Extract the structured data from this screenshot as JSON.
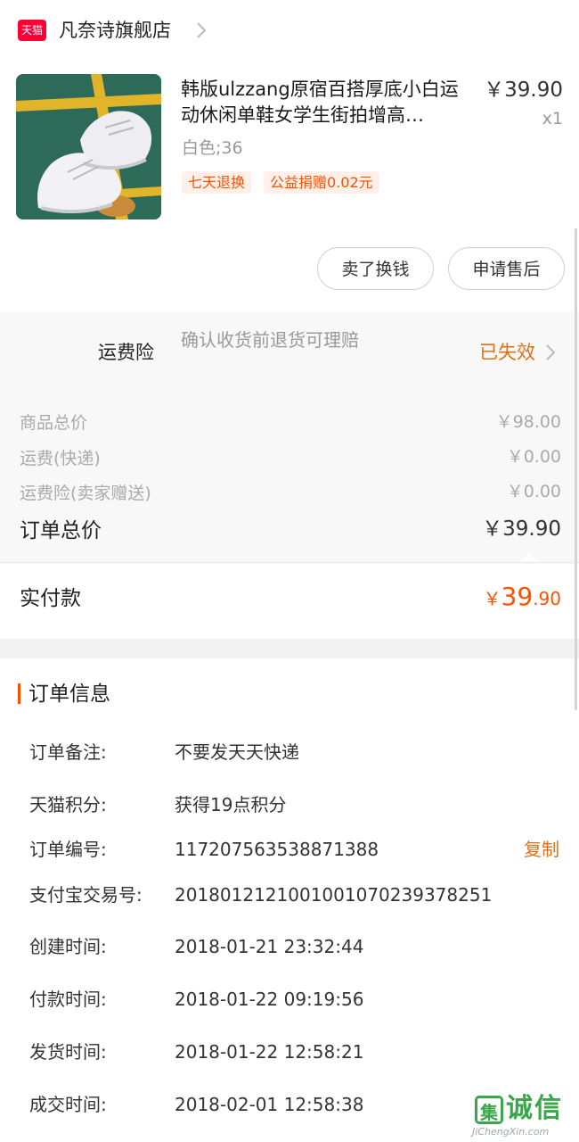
{
  "store": {
    "badge": "天猫",
    "name": "凡奈诗旗舰店"
  },
  "product": {
    "title": "韩版ulzzang原宿百搭厚底小白运动休闲单鞋女学生街拍增高…",
    "price": "￥39.90",
    "quantity": "x1",
    "variant": "白色;36",
    "tags": [
      "七天退换",
      "公益捐赠0.02元"
    ]
  },
  "actions": {
    "sell_label": "卖了换钱",
    "after_sale_label": "申请售后"
  },
  "insurance": {
    "label": "运费险",
    "description": "确认收货前退货可理赔",
    "status": "已失效"
  },
  "summary": {
    "rows": [
      {
        "label": "商品总价",
        "value": "￥98.00"
      },
      {
        "label": "运费(快递)",
        "value": "￥0.00"
      },
      {
        "label": "运费险(卖家赠送)",
        "value": "￥0.00"
      }
    ],
    "total_label": "订单总价",
    "total_value": "￥39.90",
    "paid_label": "实付款",
    "paid_currency": "￥",
    "paid_integer": "39",
    "paid_decimal": ".90"
  },
  "order_info": {
    "title": "订单信息",
    "copy_label": "复制",
    "rows": [
      {
        "label": "订单备注:",
        "value": "不要发天天快递"
      },
      {
        "label": "天猫积分:",
        "value": "获得19点积分"
      },
      {
        "label": "订单编号:",
        "value": "117207563538871388"
      },
      {
        "label": "支付宝交易号:",
        "value": "20180121210010010702393782​51"
      },
      {
        "label": "创建时间:",
        "value": "2018-01-21 23:32:44"
      },
      {
        "label": "付款时间:",
        "value": "2018-01-22 09:19:56"
      },
      {
        "label": "发货时间:",
        "value": "2018-01-22 12:58:21"
      },
      {
        "label": "成交时间:",
        "value": "2018-02-01 12:58:38"
      }
    ]
  },
  "watermark": {
    "box_char": "集",
    "text": "诚信",
    "url": "JiChengXin.com"
  },
  "colors": {
    "accent": "#ff5000",
    "tmall_red": "#ff0036",
    "status_orange": "#e07016"
  }
}
